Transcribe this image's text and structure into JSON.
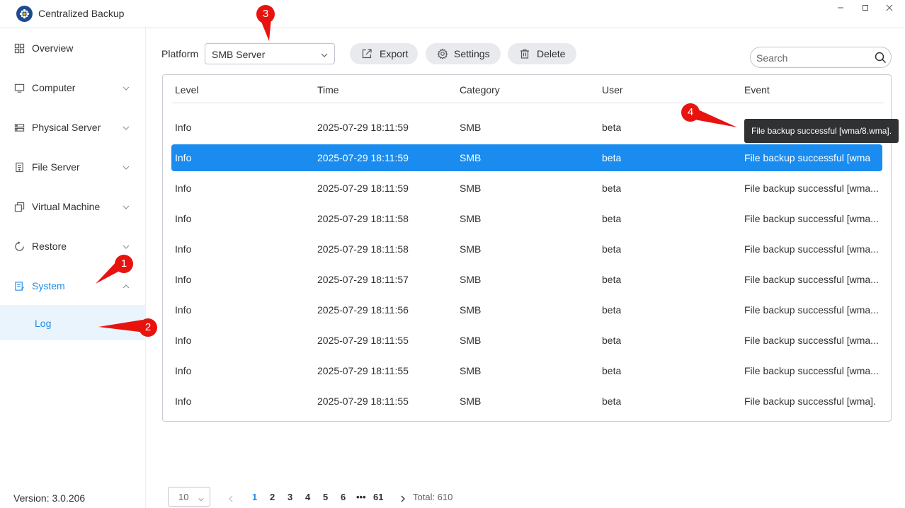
{
  "app": {
    "title": "Centralized Backup"
  },
  "sidebar": {
    "items": [
      {
        "label": "Overview",
        "icon": "grid-icon",
        "expandable": false
      },
      {
        "label": "Computer",
        "icon": "monitor-icon",
        "expandable": true
      },
      {
        "label": "Physical Server",
        "icon": "server-icon",
        "expandable": true
      },
      {
        "label": "File Server",
        "icon": "file-server-icon",
        "expandable": true
      },
      {
        "label": "Virtual Machine",
        "icon": "virtual-machine-icon",
        "expandable": true
      },
      {
        "label": "Restore",
        "icon": "restore-icon",
        "expandable": true
      },
      {
        "label": "System",
        "icon": "system-icon",
        "expandable": true,
        "expanded": true,
        "active": true
      }
    ],
    "sub_items": [
      {
        "label": "Log",
        "active": true
      }
    ],
    "version": "Version: 3.0.206"
  },
  "toolbar": {
    "platform_label": "Platform",
    "platform_value": "SMB Server",
    "export_label": "Export",
    "settings_label": "Settings",
    "delete_label": "Delete",
    "search_placeholder": "Search"
  },
  "table": {
    "columns": [
      "Level",
      "Time",
      "Category",
      "User",
      "Event"
    ],
    "rows": [
      [
        "Info",
        "2025-07-29 18:11:59",
        "SMB",
        "beta",
        ""
      ],
      [
        "Info",
        "2025-07-29 18:11:59",
        "SMB",
        "beta",
        "File backup successful [wma"
      ],
      [
        "Info",
        "2025-07-29 18:11:59",
        "SMB",
        "beta",
        "File backup successful [wma..."
      ],
      [
        "Info",
        "2025-07-29 18:11:58",
        "SMB",
        "beta",
        "File backup successful [wma..."
      ],
      [
        "Info",
        "2025-07-29 18:11:58",
        "SMB",
        "beta",
        "File backup successful [wma..."
      ],
      [
        "Info",
        "2025-07-29 18:11:57",
        "SMB",
        "beta",
        "File backup successful [wma..."
      ],
      [
        "Info",
        "2025-07-29 18:11:56",
        "SMB",
        "beta",
        "File backup successful [wma..."
      ],
      [
        "Info",
        "2025-07-29 18:11:55",
        "SMB",
        "beta",
        "File backup successful [wma..."
      ],
      [
        "Info",
        "2025-07-29 18:11:55",
        "SMB",
        "beta",
        "File backup successful [wma..."
      ],
      [
        "Info",
        "2025-07-29 18:11:55",
        "SMB",
        "beta",
        "File backup successful [wma]."
      ]
    ],
    "selected_row": 1,
    "tooltip": "File backup successful [wma/8.wma]."
  },
  "pagination": {
    "page_size": "10",
    "pages": [
      "1",
      "2",
      "3",
      "4",
      "5",
      "6",
      "•••",
      "61"
    ],
    "current": "1",
    "total": "Total: 610"
  },
  "annotations": [
    "1",
    "2",
    "3",
    "4"
  ],
  "colors": {
    "accent": "#1a8cf0",
    "marker": "#e8130f",
    "selected_row": "#1a8cf0"
  }
}
